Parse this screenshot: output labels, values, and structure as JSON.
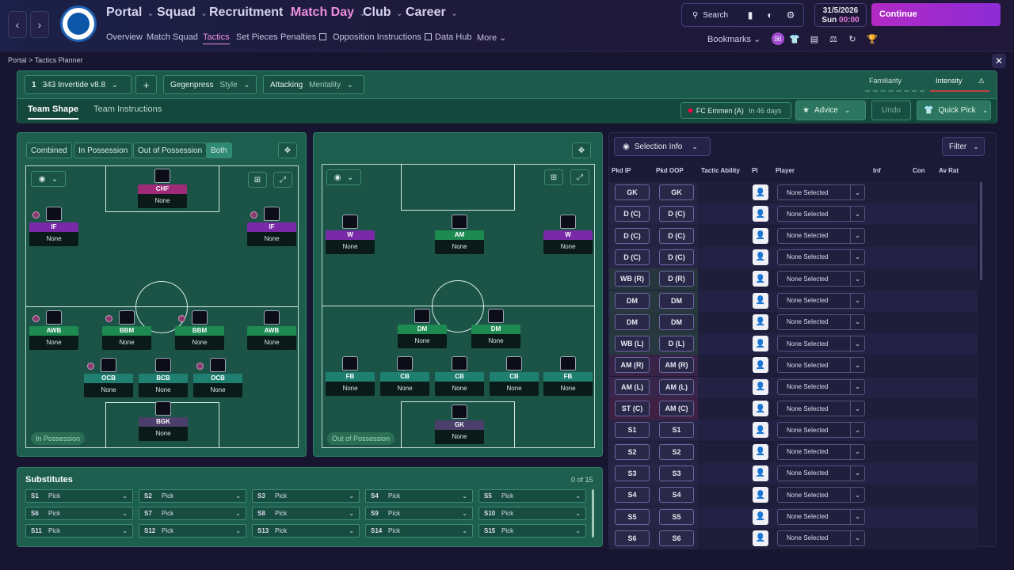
{
  "topnav": {
    "main": [
      {
        "label": "Portal"
      },
      {
        "label": "Squad"
      },
      {
        "label": "Recruitment"
      },
      {
        "label": "Match Day"
      },
      {
        "label": "Club"
      },
      {
        "label": "Career"
      }
    ],
    "sub": [
      {
        "label": "Overview"
      },
      {
        "label": "Match Squad"
      },
      {
        "label": "Tactics"
      },
      {
        "label": "Set Pieces"
      },
      {
        "label": "Penalties"
      },
      {
        "label": "Opposition Instructions"
      },
      {
        "label": "Data Hub"
      },
      {
        "label": "More"
      }
    ],
    "search_label": "Search",
    "date": "31/5/2026",
    "day": "Sun",
    "time": "00:00",
    "continue_label": "Continue",
    "bookmarks_label": "Bookmarks",
    "icons": [
      "back-arrow-icon",
      "forward-arrow-icon",
      "club-crest-icon",
      "search-icon",
      "bookmark-icon",
      "brain-icon",
      "gear-icon",
      "chat-icon",
      "shirt-icon",
      "document-icon",
      "scales-icon",
      "refresh-icon",
      "trophy-icon"
    ]
  },
  "breadcrumb": {
    "portal": "Portal",
    "current": "Tactics Planner"
  },
  "toolbar": {
    "tactic_number": "1",
    "tactic_name": "343 Invertide v8.8",
    "add": "+",
    "style_value": "Gegenpress",
    "style_label": "Style",
    "mentality_value": "Attacking",
    "mentality_label": "Mentality",
    "familiarity": "Familiarity",
    "intensity": "Intensity"
  },
  "tabs": {
    "team_shape": "Team Shape",
    "team_instructions": "Team Instructions"
  },
  "next_match": {
    "opponent": "FC Emmen (A)",
    "when": "In 46 days"
  },
  "buttons": {
    "advice": "Advice",
    "undo": "Undo",
    "quick_pick": "Quick Pick"
  },
  "view_toggle": {
    "combined": "Combined",
    "in_possession": "In Possession",
    "out_of_possession": "Out of Possession",
    "both": "Both"
  },
  "colors": {
    "attack_role": "#7a2aa8",
    "midfield_role": "#1d8a52",
    "defence_role": "#1f8072",
    "keeper_role": "#4a3f6a",
    "forward_role": "#9e2a78",
    "accent": "#b229c4"
  },
  "in_possession": {
    "label": "In Possession",
    "players": [
      {
        "role": "CHF",
        "name": "None",
        "color": "#9e2a78"
      },
      {
        "role": "IF",
        "name": "None",
        "color": "#7a2aa8"
      },
      {
        "role": "IF",
        "name": "None",
        "color": "#7a2aa8"
      },
      {
        "role": "AWB",
        "name": "None",
        "color": "#1d8a52"
      },
      {
        "role": "BBM",
        "name": "None",
        "color": "#1d8a52"
      },
      {
        "role": "BBM",
        "name": "None",
        "color": "#1d8a52"
      },
      {
        "role": "AWB",
        "name": "None",
        "color": "#1d8a52"
      },
      {
        "role": "OCB",
        "name": "None",
        "color": "#1f8072"
      },
      {
        "role": "BCB",
        "name": "None",
        "color": "#1f8072"
      },
      {
        "role": "OCB",
        "name": "None",
        "color": "#1f8072"
      },
      {
        "role": "BGK",
        "name": "None",
        "color": "#4a3f6a"
      }
    ]
  },
  "out_of_possession": {
    "label": "Out of Possession",
    "players": [
      {
        "role": "W",
        "name": "None",
        "color": "#7a2aa8"
      },
      {
        "role": "AM",
        "name": "None",
        "color": "#1d8a52"
      },
      {
        "role": "W",
        "name": "None",
        "color": "#7a2aa8"
      },
      {
        "role": "DM",
        "name": "None",
        "color": "#1d8a52"
      },
      {
        "role": "DM",
        "name": "None",
        "color": "#1d8a52"
      },
      {
        "role": "FB",
        "name": "None",
        "color": "#1f8072"
      },
      {
        "role": "CB",
        "name": "None",
        "color": "#1f8072"
      },
      {
        "role": "CB",
        "name": "None",
        "color": "#1f8072"
      },
      {
        "role": "CB",
        "name": "None",
        "color": "#1f8072"
      },
      {
        "role": "FB",
        "name": "None",
        "color": "#1f8072"
      },
      {
        "role": "GK",
        "name": "None",
        "color": "#4a3f6a"
      }
    ]
  },
  "substitutes": {
    "title": "Substitutes",
    "count": "0 of 15",
    "slots": [
      {
        "id": "S1",
        "value": "Pick"
      },
      {
        "id": "S2",
        "value": "Pick"
      },
      {
        "id": "S3",
        "value": "Pick"
      },
      {
        "id": "S4",
        "value": "Pick"
      },
      {
        "id": "S5",
        "value": "Pick"
      },
      {
        "id": "S6",
        "value": "Pick"
      },
      {
        "id": "S7",
        "value": "Pick"
      },
      {
        "id": "S8",
        "value": "Pick"
      },
      {
        "id": "S9",
        "value": "Pick"
      },
      {
        "id": "S10",
        "value": "Pick"
      },
      {
        "id": "S11",
        "value": "Pick"
      },
      {
        "id": "S12",
        "value": "Pick"
      },
      {
        "id": "S13",
        "value": "Pick"
      },
      {
        "id": "S14",
        "value": "Pick"
      },
      {
        "id": "S15",
        "value": "Pick"
      }
    ]
  },
  "selection": {
    "info_label": "Selection Info",
    "filter_label": "Filter",
    "headers": {
      "ip": "Pkd IP",
      "oop": "Pkd OOP",
      "ability": "Tactic Ability",
      "pi": "PI",
      "player": "Player",
      "inf": "Inf",
      "con": "Con",
      "avrat": "Av Rat"
    },
    "rows": [
      {
        "ip": "GK",
        "oop": "GK",
        "player": "None Selected"
      },
      {
        "ip": "D (C)",
        "oop": "D (C)",
        "player": "None Selected"
      },
      {
        "ip": "D (C)",
        "oop": "D (C)",
        "player": "None Selected"
      },
      {
        "ip": "D (C)",
        "oop": "D (C)",
        "player": "None Selected"
      },
      {
        "ip": "WB (R)",
        "oop": "D (R)",
        "player": "None Selected"
      },
      {
        "ip": "DM",
        "oop": "DM",
        "player": "None Selected"
      },
      {
        "ip": "DM",
        "oop": "DM",
        "player": "None Selected"
      },
      {
        "ip": "WB (L)",
        "oop": "D (L)",
        "player": "None Selected"
      },
      {
        "ip": "AM (R)",
        "oop": "AM (R)",
        "player": "None Selected"
      },
      {
        "ip": "AM (L)",
        "oop": "AM (L)",
        "player": "None Selected"
      },
      {
        "ip": "ST (C)",
        "oop": "AM (C)",
        "player": "None Selected"
      },
      {
        "ip": "S1",
        "oop": "S1",
        "player": "None Selected"
      },
      {
        "ip": "S2",
        "oop": "S2",
        "player": "None Selected"
      },
      {
        "ip": "S3",
        "oop": "S3",
        "player": "None Selected"
      },
      {
        "ip": "S4",
        "oop": "S4",
        "player": "None Selected"
      },
      {
        "ip": "S5",
        "oop": "S5",
        "player": "None Selected"
      },
      {
        "ip": "S6",
        "oop": "S6",
        "player": "None Selected"
      }
    ]
  }
}
